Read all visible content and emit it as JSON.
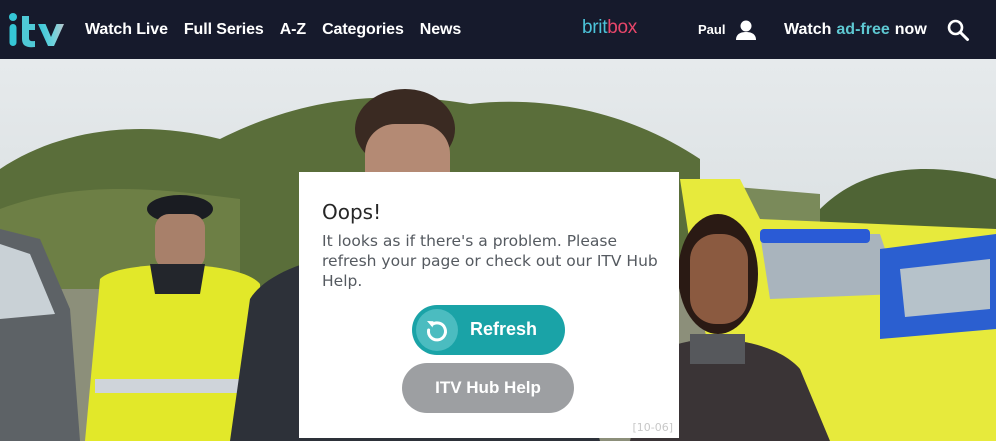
{
  "header": {
    "logo_text": "itv",
    "nav": [
      {
        "label": "Watch Live"
      },
      {
        "label": "Full Series"
      },
      {
        "label": "A-Z"
      },
      {
        "label": "Categories"
      },
      {
        "label": "News"
      }
    ],
    "britbox": {
      "part1": "brit",
      "part2": "box"
    },
    "user": {
      "name": "Paul",
      "icon": "user-icon"
    },
    "adfree": {
      "pre": "Watch",
      "highlight": "ad-free",
      "post": "now"
    },
    "search_icon": "search-icon"
  },
  "dialog": {
    "title": "Oops!",
    "message": "It looks as if there's a problem. Please refresh your page or check out our ITV Hub Help.",
    "refresh_label": "Refresh",
    "refresh_icon": "refresh-icon",
    "help_label": "ITV Hub Help",
    "error_code": "[10-06]"
  },
  "colors": {
    "nav_bg": "#161a2c",
    "accent_teal": "#1aa3a7",
    "britbox_blue": "#4cc3d9",
    "britbox_pink": "#e8466a",
    "help_grey": "#9d9fa2"
  }
}
